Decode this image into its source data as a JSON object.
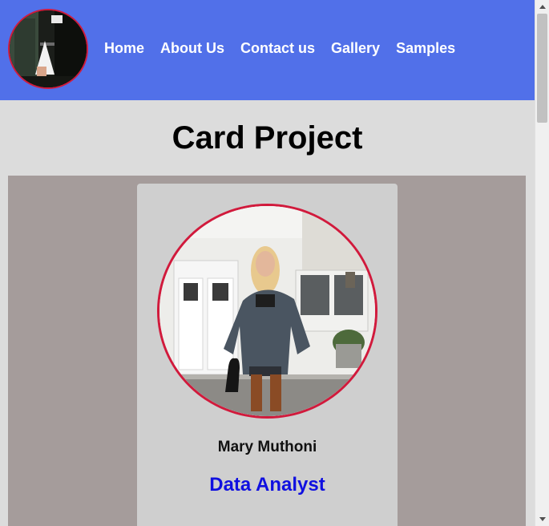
{
  "nav": {
    "logo_alt": "Site logo",
    "links": [
      "Home",
      "About Us",
      "Contact us",
      "Gallery",
      "Samples"
    ]
  },
  "page": {
    "title": "Card Project"
  },
  "card": {
    "name": "Mary Muthoni",
    "role": "Data Analyst"
  },
  "colors": {
    "navbar": "#5170e9",
    "page_bg": "#dcdcdc",
    "card_area_bg": "#a59c9b",
    "card_bg": "#cfcfcf",
    "accent_border": "#d11a3c",
    "role_text": "#1010e0"
  }
}
